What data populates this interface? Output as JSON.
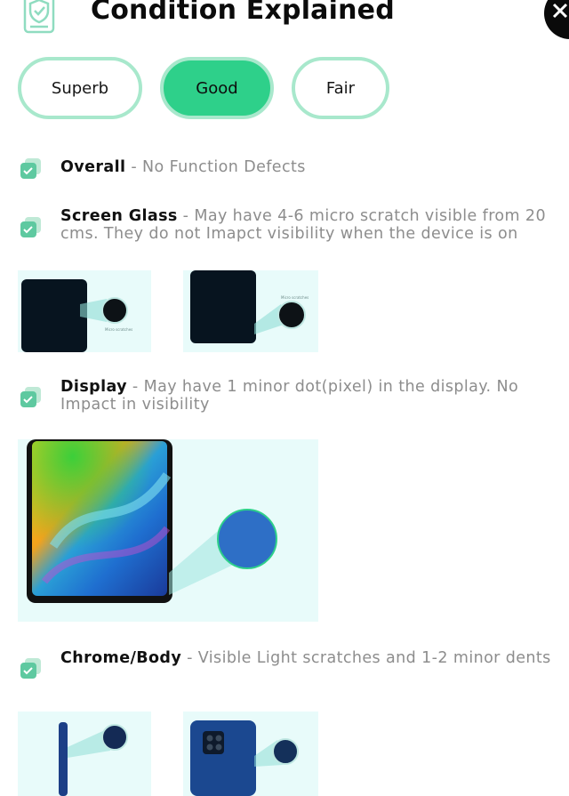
{
  "header": {
    "title": "Condition Explained",
    "icon": "checklist-icon",
    "close_icon": "close-icon"
  },
  "tabs": [
    {
      "label": "Superb",
      "selected": false
    },
    {
      "label": "Good",
      "selected": true
    },
    {
      "label": "Fair",
      "selected": false
    }
  ],
  "colors": {
    "accent": "#2ed08a",
    "tab_border": "#a8e8cc",
    "panel_bg": "#e8fbfa",
    "text_muted": "#8d8d8d"
  },
  "sections": [
    {
      "title": "Overall",
      "description": " - No Function Defects",
      "icon": "check-icon"
    },
    {
      "title": "Screen Glass",
      "description": " - May have 4-6 micro scratch visible from 20 cms. They do not Imapct visibility when the device is on",
      "icon": "check-icon"
    },
    {
      "title": "Display",
      "description": " - May have 1 minor dot(pixel) in the display. No Impact in visibility",
      "icon": "check-icon"
    },
    {
      "title": "Chrome/Body",
      "description": " - Visible Light scratches and 1-2 minor dents",
      "icon": "check-icon"
    }
  ],
  "image_labels": {
    "micro_scratches_a": "Micro scratches",
    "micro_scratches_b": "Micro scratches"
  }
}
